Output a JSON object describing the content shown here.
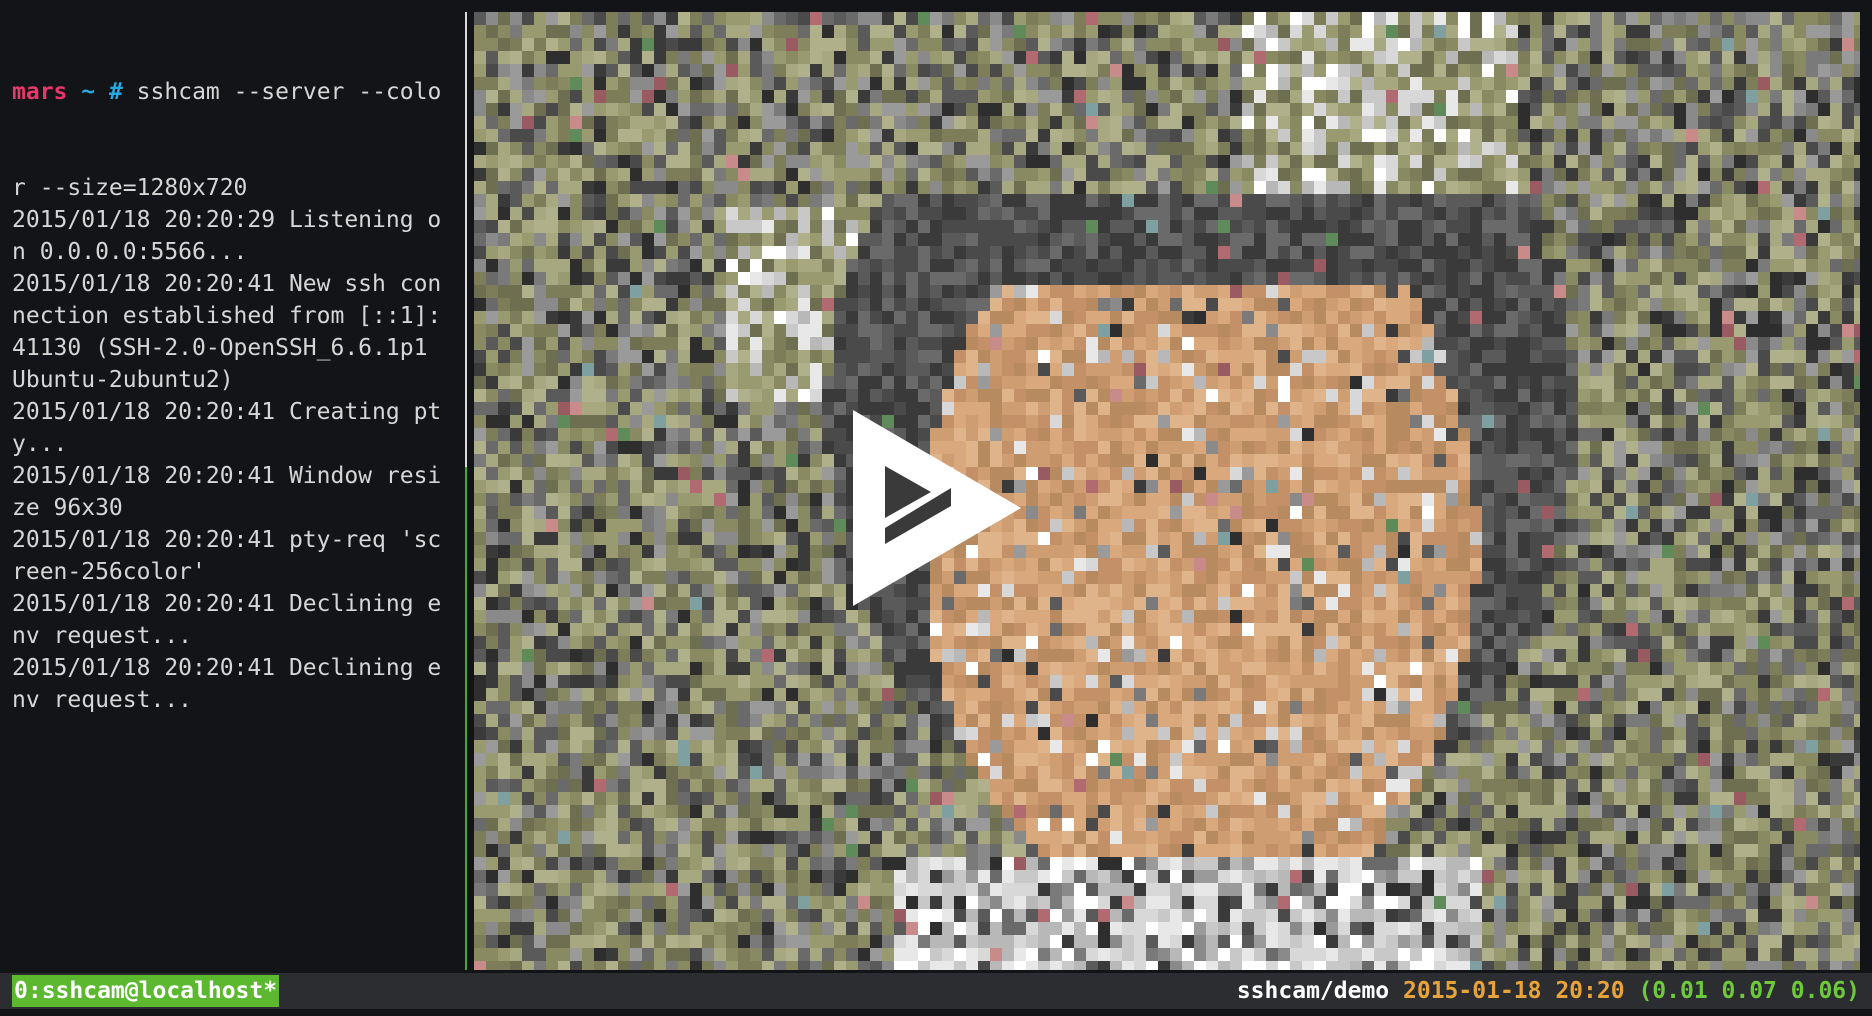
{
  "terminal": {
    "prompt": {
      "host": "mars",
      "cwd": "~",
      "symbol": "#",
      "command": " sshcam --server --colo"
    },
    "lines": [
      "r --size=1280x720",
      "2015/01/18 20:20:29 Listening o",
      "n 0.0.0.0:5566...",
      "2015/01/18 20:20:41 New ssh con",
      "nection established from [::1]:",
      "41130 (SSH-2.0-OpenSSH_6.6.1p1",
      "Ubuntu-2ubuntu2)",
      "2015/01/18 20:20:41 Creating pt",
      "y...",
      "2015/01/18 20:20:41 Window resi",
      "ze 96x30",
      "2015/01/18 20:20:41 pty-req 'sc",
      "reen-256color'",
      "2015/01/18 20:20:41 Declining e",
      "nv request...",
      "2015/01/18 20:20:41 Declining e",
      "nv request..."
    ]
  },
  "player": {
    "play_icon": "asciinema-play-icon"
  },
  "statusbar": {
    "window": "0:sshcam@localhost*",
    "session": "sshcam/demo",
    "datetime": "2015-01-18 20:20",
    "loadavg": "(0.01 0.07 0.06)"
  },
  "colors": {
    "background": "#121417",
    "prompt_host": "#e8376b",
    "prompt_symbol": "#27a8e0",
    "status_window": "#5bb82f",
    "status_date": "#e8a33a",
    "status_load": "#6ec93a"
  }
}
